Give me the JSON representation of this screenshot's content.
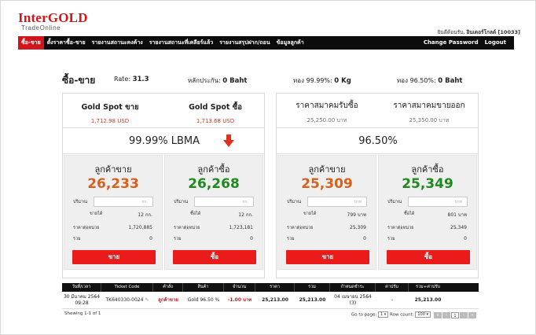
{
  "brand": {
    "name": "InterGOLD",
    "sub": "TradeOnline"
  },
  "welcome": {
    "prefix": "ยินดีต้อนรับ, ",
    "user": "อินเตอร์โกลด์ [10033]"
  },
  "nav": {
    "left": [
      "ซื้อ-ขาย",
      "ตั้งราคาซื้อ-ขาย",
      "รายงานสถานะคงค้าง",
      "รายงานสถานะที่เคลียร์แล้ว",
      "รายงานสรุปฝาก/ถอน",
      "ข้อมูลลูกค้า"
    ],
    "right": [
      "Change Password",
      "Logout"
    ]
  },
  "summary": {
    "title": "ซื้อ-ขาย",
    "rate_label": "Rate:",
    "rate_value": "31.3",
    "deposit_label": "หลักประกัน:",
    "deposit_value": "0 Baht",
    "gold9999_label": "ทอง 99.99%:",
    "gold9999_value": "0 Kg",
    "gold9650_label": "ทอง 96.50%:",
    "gold9650_value": "0 Baht"
  },
  "left_panel": {
    "spot_sell_label": "Gold Spot ขาย",
    "spot_sell_value": "1,712.98 USD",
    "spot_buy_label": "Gold Spot ซื้อ",
    "spot_buy_value": "1,713.68 USD",
    "product": "99.99% LBMA",
    "sell": {
      "title": "ลูกค้าขาย",
      "price": "26,233",
      "qty_label": "ปริมาณ",
      "qty_placeholder": "กก.",
      "qty_sold_label": "ขายได้",
      "qty_sold_value": "12 กก.",
      "unit_price_label": "ราคาต่อหน่วย",
      "unit_price_value": "1,720,885",
      "total_label": "รวม",
      "total_value": "0",
      "button": "ขาย"
    },
    "buy": {
      "title": "ลูกค้าซื้อ",
      "price": "26,268",
      "qty_label": "ปริมาณ",
      "qty_placeholder": "กก.",
      "qty_sold_label": "ซื้อได้",
      "qty_sold_value": "12 กก.",
      "unit_price_label": "ราคาต่อหน่วย",
      "unit_price_value": "1,723,181",
      "total_label": "รวม",
      "total_value": "0",
      "button": "ซื้อ"
    }
  },
  "right_panel": {
    "assoc_buy_label": "ราคาสมาคมรับซื้อ",
    "assoc_buy_value": "25,250.00 บาท",
    "assoc_sell_label": "ราคาสมาคมขายออก",
    "assoc_sell_value": "25,350.00 บาท",
    "product": "96.50%",
    "sell": {
      "title": "ลูกค้าขาย",
      "price": "25,309",
      "qty_label": "ปริมาณ",
      "qty_placeholder": "บาท",
      "qty_sold_label": "ขายได้",
      "qty_sold_value": "799 บาท",
      "unit_price_label": "ราคาต่อหน่วย",
      "unit_price_value": "25,309",
      "total_label": "รวม",
      "total_value": "0",
      "button": "ขาย"
    },
    "buy": {
      "title": "ลูกค้าซื้อ",
      "price": "25,349",
      "qty_label": "ปริมาณ",
      "qty_placeholder": "บาท",
      "qty_sold_label": "ซื้อได้",
      "qty_sold_value": "801 บาท",
      "unit_price_label": "ราคาต่อหน่วย",
      "unit_price_value": "25,349",
      "total_label": "รวม",
      "total_value": "0",
      "button": "ซื้อ"
    }
  },
  "table": {
    "headers": [
      "วันที่/เวลา",
      "Ticket Code",
      "คำสั่ง",
      "สินค้า",
      "จำนวน",
      "ราคา",
      "รวม",
      "กำหนดชำระ",
      "ค่าปรับ",
      "รวม+ค่าปรับ"
    ],
    "row": {
      "date": "30 มีนาคม 2564",
      "time": "09:28",
      "ticket": "TK640330-0024",
      "order": "ลูกค้าขาย",
      "product": "Gold 96.50 %",
      "qty": "-1.00 บาท",
      "price": "25,213.00",
      "total": "25,213.00",
      "due1": "04 เมษายน 2564",
      "due2": "(3)",
      "fine": "-",
      "grand": "25,213.00"
    }
  },
  "footer": {
    "showing": "Showing 1-1 of 1",
    "goto_label": "Go to page:",
    "goto_value": "1",
    "rowcount_label": "Row count:",
    "rowcount_value": "100",
    "current_page": "1"
  },
  "colors": {
    "brand_red": "#d0161c",
    "sell_price": "#d4611e",
    "buy_price": "#1f8a1f",
    "button_red": "#ea1b1b",
    "arrow": "#e0301e"
  }
}
